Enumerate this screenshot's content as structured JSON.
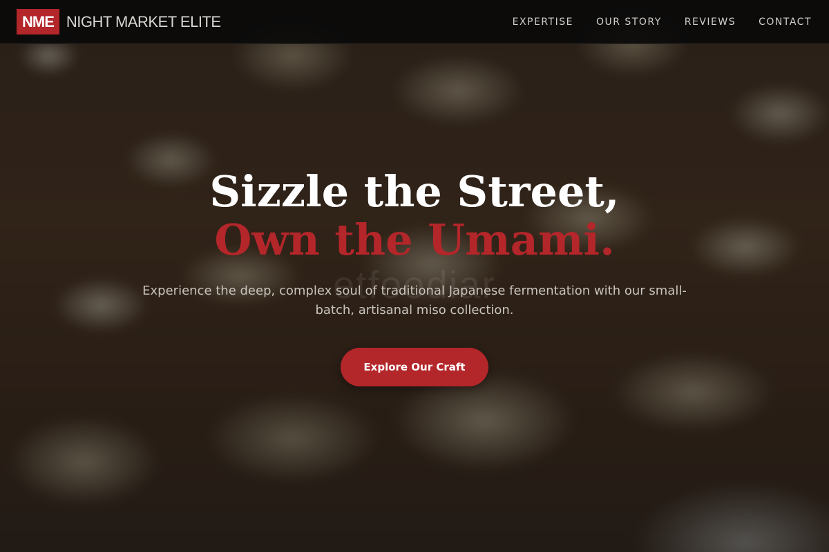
{
  "header": {
    "logo_badge": "NME",
    "brand_name": "NIGHT MARKET ELITE",
    "nav": [
      {
        "label": "EXPERTISE"
      },
      {
        "label": "OUR STORY"
      },
      {
        "label": "REVIEWS"
      },
      {
        "label": "CONTACT"
      }
    ]
  },
  "hero": {
    "headline_line1": "Sizzle the Street,",
    "headline_line2": "Own the Umami.",
    "watermark": "etfoodiar",
    "subtitle": "Experience the deep, complex soul of traditional Japanese fermentation with our small-batch, artisanal miso collection.",
    "cta_label": "Explore Our Craft"
  },
  "colors": {
    "accent": "#b3262a",
    "header_bg": "#0a0a0a",
    "headline_primary": "#ffffff"
  }
}
